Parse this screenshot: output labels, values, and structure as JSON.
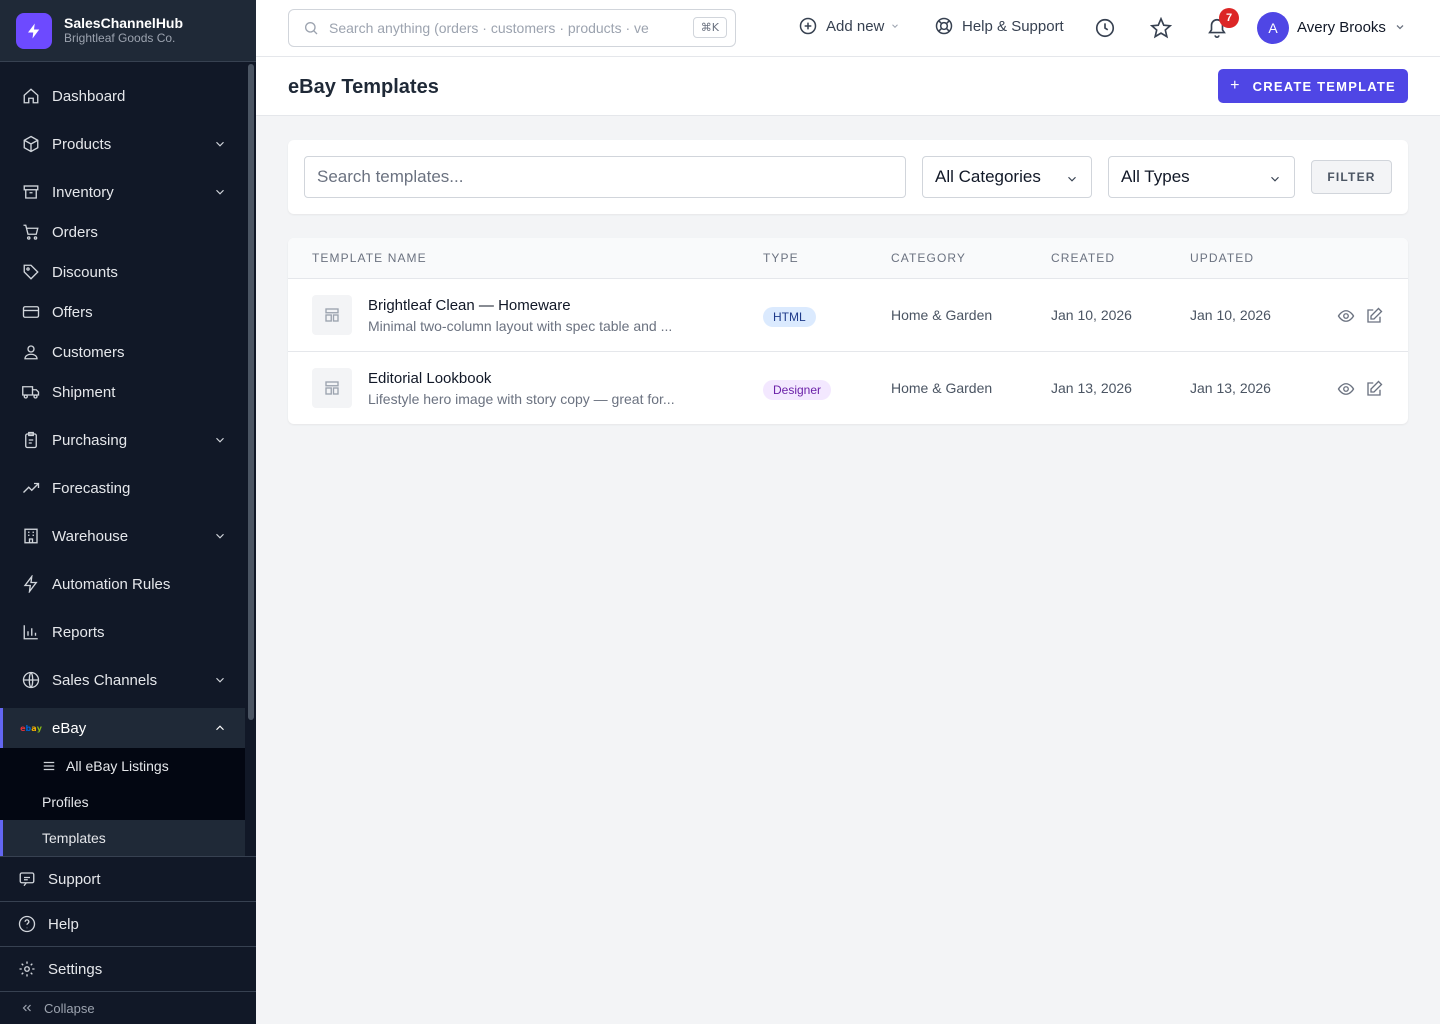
{
  "brand": {
    "name": "SalesChannelHub",
    "company": "Brightleaf Goods Co."
  },
  "sidebar": {
    "items": [
      {
        "label": "Dashboard",
        "icon": "home-icon"
      },
      {
        "label": "Products",
        "icon": "box-icon",
        "expandable": true
      },
      {
        "label": "Inventory",
        "icon": "archive-icon",
        "expandable": true
      },
      {
        "label": "Orders",
        "icon": "cart-icon"
      },
      {
        "label": "Discounts",
        "icon": "tag-icon"
      },
      {
        "label": "Offers",
        "icon": "card-icon"
      },
      {
        "label": "Customers",
        "icon": "users-icon"
      },
      {
        "label": "Shipment",
        "icon": "truck-icon"
      },
      {
        "label": "Purchasing",
        "icon": "clipboard-icon",
        "expandable": true
      },
      {
        "label": "Forecasting",
        "icon": "trend-icon"
      },
      {
        "label": "Warehouse",
        "icon": "building-icon",
        "expandable": true
      },
      {
        "label": "Automation Rules",
        "icon": "bolt-icon"
      },
      {
        "label": "Reports",
        "icon": "bar-chart-icon"
      },
      {
        "label": "Sales Channels",
        "icon": "globe-icon",
        "expandable": true
      },
      {
        "label": "eBay",
        "icon": "ebay-logo",
        "expanded": true
      }
    ],
    "ebay_sub": [
      {
        "label": "All eBay Listings",
        "icon": "list-icon"
      },
      {
        "label": "Profiles"
      },
      {
        "label": "Templates",
        "active": true
      }
    ],
    "bottom": [
      {
        "label": "Support",
        "icon": "chat-icon"
      },
      {
        "label": "Help",
        "icon": "question-icon"
      },
      {
        "label": "Settings",
        "icon": "gear-icon"
      }
    ],
    "collapse_label": "Collapse"
  },
  "topbar": {
    "search_placeholder": "Search anything (orders · customers · products · ve",
    "search_shortcut": "⌘K",
    "add_new": "Add new",
    "help": "Help & Support",
    "notifications_count": "7",
    "avatar_initial": "A",
    "user_name": "Avery Brooks"
  },
  "page": {
    "title": "eBay Templates",
    "create_button": "CREATE TEMPLATE"
  },
  "filters": {
    "search_placeholder": "Search templates...",
    "category": "All Categories",
    "type": "All Types",
    "filter_button": "FILTER"
  },
  "table": {
    "headers": [
      "TEMPLATE NAME",
      "TYPE",
      "CATEGORY",
      "CREATED",
      "UPDATED"
    ],
    "rows": [
      {
        "name": "Brightleaf Clean — Homeware",
        "desc": "Minimal two-column layout with spec table and ...",
        "type": "HTML",
        "type_color": "#dbeafe",
        "type_text": "#1e3a8a",
        "category": "Home & Garden",
        "created": "Jan 10, 2026",
        "updated": "Jan 10, 2026"
      },
      {
        "name": "Editorial Lookbook",
        "desc": "Lifestyle hero image with story copy — great for...",
        "type": "Designer",
        "type_color": "#f3e8ff",
        "type_text": "#6b21a8",
        "category": "Home & Garden",
        "created": "Jan 13, 2026",
        "updated": "Jan 13, 2026"
      }
    ]
  },
  "colors": {
    "accent": "#4f46e5",
    "sidebar_bg": "#111827",
    "brand_logo": "#6d4aff"
  }
}
